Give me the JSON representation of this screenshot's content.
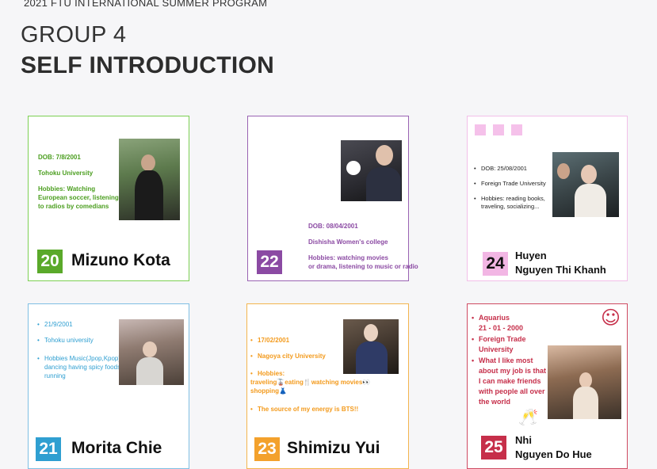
{
  "header": {
    "program": "2021 FTU INTERNATIONAL SUMMER PROGRAM",
    "group": "GROUP 4",
    "title": "SELF INTRODUCTION"
  },
  "colors": {
    "green": "#5aa92a",
    "purple": "#8b4aa3",
    "pink": "#f2b6e4",
    "blue": "#2f9fd1",
    "orange": "#f3a12c",
    "crimson": "#c62f4a"
  },
  "cards": {
    "c20": {
      "number": "20",
      "name": "Mizuno Kota",
      "dob": "DOB: 7/8/2001",
      "school": "Tohoku University",
      "hobbies": "Hobbies: Watching European soccer, listening to radios by comedians"
    },
    "c22": {
      "number": "22",
      "dob": "DOB: 08/04/2001",
      "school": "Dishisha Women's college",
      "hobbies_line1": "Hobbies: watching movies",
      "hobbies_line2": "or drama, listening to music or radio"
    },
    "c24": {
      "number": "24",
      "name_line1": "Huyen",
      "name_line2": "Nguyen Thi Khanh",
      "dob": "DOB: 25/08/2001",
      "school": "Foreign Trade University",
      "hobbies": "Hobbies: reading books, traveling, socializing..."
    },
    "c21": {
      "number": "21",
      "name": "Morita Chie",
      "dob": "21/9/2001",
      "school": "Tohoku university",
      "hobbies": "Hobbies Music(Jpop,Kpop), dancing having spicy foods running"
    },
    "c23": {
      "number": "23",
      "name": "Shimizu Yui",
      "dob": "17/02/2001",
      "school": "Nagoya city University",
      "hobbies_label": "Hobbies:",
      "hobbies": "traveling🚡eating🍴watching movies👀 shopping👗",
      "energy": "The  source of my energy is BTS!!"
    },
    "c25": {
      "number": "25",
      "name_line1": "Nhi",
      "name_line2": "Nguyen Do Hue",
      "sign": "Aquarius",
      "dob": "21 - 01 - 2000",
      "school": "Foreign Trade University",
      "like": "What I like most about my job is that I can make friends with people all over the world",
      "smiley": "☺",
      "cheers": "🥂"
    }
  }
}
